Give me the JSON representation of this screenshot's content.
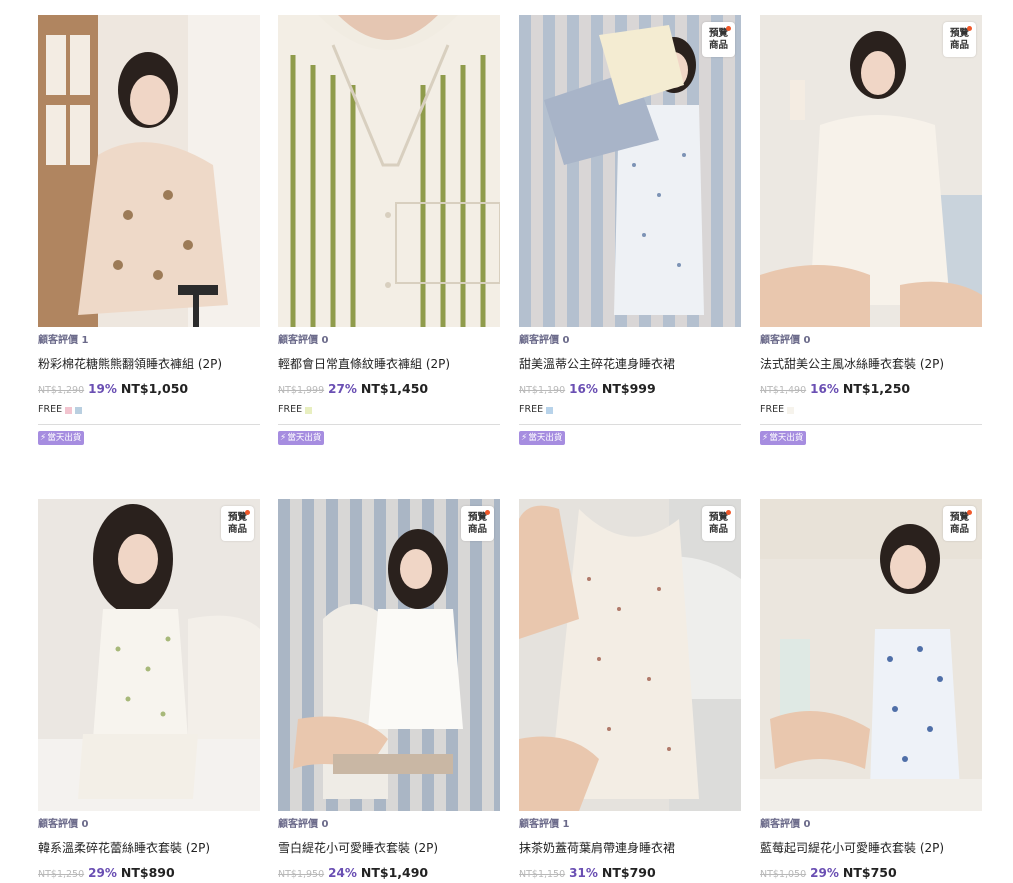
{
  "products": [
    {
      "review_label": "顧客評價 1",
      "name": "粉彩棉花糖熊熊翻領睡衣褲組 (2P)",
      "original_price": "NT$1,290",
      "discount": "19%",
      "sale_price": "NT$1,050",
      "size": "FREE",
      "swatches": [
        "#f2c4cf",
        "#b9cfe0"
      ],
      "ship_label": "當天出貨",
      "preorder": false,
      "photo_theme": "pink-bear-pajamas"
    },
    {
      "review_label": "顧客評價 0",
      "name": "輕都會日常直條紋睡衣褲組 (2P)",
      "original_price": "NT$1,999",
      "discount": "27%",
      "sale_price": "NT$1,450",
      "size": "FREE",
      "swatches": [
        "#e8efc0"
      ],
      "ship_label": "當天出貨",
      "preorder": false,
      "photo_theme": "green-stripe-shirt"
    },
    {
      "review_label": "顧客評價 0",
      "name": "甜美溫蒂公主碎花連身睡衣裙",
      "original_price": "NT$1,190",
      "discount": "16%",
      "sale_price": "NT$999",
      "size": "FREE",
      "swatches": [
        "#b8d3ea"
      ],
      "ship_label": "當天出貨",
      "preorder": true,
      "preorder_label": [
        "預覽",
        "商品"
      ],
      "photo_theme": "floral-dress-pillows"
    },
    {
      "review_label": "顧客評價 0",
      "name": "法式甜美公主風冰絲睡衣套裝 (2P)",
      "original_price": "NT$1,490",
      "discount": "16%",
      "sale_price": "NT$1,250",
      "size": "FREE",
      "swatches": [
        "#f6f3ec"
      ],
      "ship_label": "當天出貨",
      "preorder": true,
      "preorder_label": [
        "預覽",
        "商品"
      ],
      "photo_theme": "white-satin-set"
    },
    {
      "review_label": "顧客評價 0",
      "name": "韓系溫柔碎花蕾絲睡衣套裝 (2P)",
      "original_price": "NT$1,250",
      "discount": "29%",
      "sale_price": "NT$890",
      "preorder": true,
      "preorder_label": [
        "預覽",
        "商品"
      ],
      "photo_theme": "floral-lace-cami"
    },
    {
      "review_label": "顧客評價 0",
      "name": "雪白緹花小可愛睡衣套裝 (2P)",
      "original_price": "NT$1,950",
      "discount": "24%",
      "sale_price": "NT$1,490",
      "preorder": true,
      "preorder_label": [
        "預覽",
        "商品"
      ],
      "photo_theme": "white-jacquard-set"
    },
    {
      "review_label": "顧客評價 1",
      "name": "抹茶奶蓋荷葉肩帶連身睡衣裙",
      "original_price": "NT$1,150",
      "discount": "31%",
      "sale_price": "NT$790",
      "preorder": true,
      "preorder_label": [
        "預覽",
        "商品"
      ],
      "photo_theme": "ruffle-strap-dress"
    },
    {
      "review_label": "顧客評價 0",
      "name": "藍莓起司緹花小可愛睡衣套裝 (2P)",
      "original_price": "NT$1,050",
      "discount": "29%",
      "sale_price": "NT$750",
      "preorder": true,
      "preorder_label": [
        "預覽",
        "商品"
      ],
      "photo_theme": "blueberry-floral-set"
    }
  ],
  "colors": {
    "discount": "#6a4fb3",
    "ship_badge": "#a68de0",
    "preorder_dot": "#f0582a"
  }
}
